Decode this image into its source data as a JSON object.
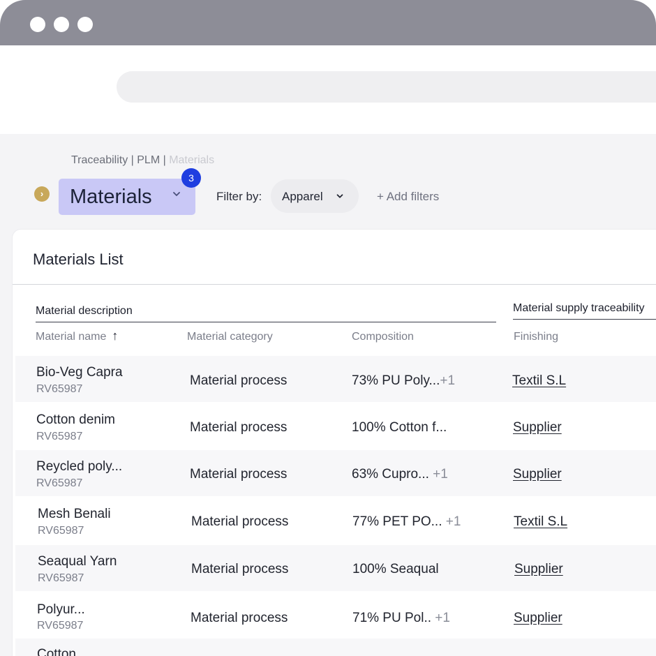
{
  "breadcrumb": {
    "path": "Traceability | PLM | ",
    "current": "Materials"
  },
  "header": {
    "view_select_label": "Materials",
    "badge_count": "3",
    "filter_label": "Filter by:",
    "filter_value": "Apparel",
    "add_filters": "+ Add filters"
  },
  "card": {
    "title": "Materials List"
  },
  "table": {
    "groups": [
      "Material description",
      "Material supply traceability"
    ],
    "columns": [
      "Material name",
      "Material category",
      "Composition",
      "Finishing"
    ],
    "rows": [
      {
        "name": "Bio-Veg Capra",
        "code": "RV65987",
        "category": "Material process",
        "composition": "73% PU Poly...",
        "more": "+1",
        "finishing": "Textil S.L"
      },
      {
        "name": "Cotton denim",
        "code": "RV65987",
        "category": "Material process",
        "composition": "100% Cotton f...",
        "more": "",
        "finishing": "Supplier"
      },
      {
        "name": "Reycled poly...",
        "code": "RV65987",
        "category": "Material process",
        "composition": "63% Cupro... ",
        "more": "+1",
        "finishing": "Supplier"
      },
      {
        "name": "Mesh Benali",
        "code": "RV65987",
        "category": "Material process",
        "composition": "77% PET PO... ",
        "more": "+1",
        "finishing": "Textil S.L"
      },
      {
        "name": "Seaqual Yarn",
        "code": "RV65987",
        "category": "Material process",
        "composition": "100% Seaqual",
        "more": "",
        "finishing": "Supplier"
      },
      {
        "name": "Polyur...",
        "code": "RV65987",
        "category": "Material process",
        "composition": "71% PU Pol.. ",
        "more": "+1",
        "finishing": "Supplier"
      },
      {
        "name": "Cotton",
        "code": "",
        "category": "",
        "composition": "",
        "more": "",
        "finishing": ""
      }
    ]
  },
  "icons": {
    "sort": "up-arrow-icon",
    "expand": "chevron-right-icon",
    "dropdown": "chevron-down-icon"
  },
  "colors": {
    "accent_badge": "#1f3ee0",
    "view_select_bg": "#c9c8f6",
    "expand_button": "#c8a85a",
    "titlebar": "#8d8d97"
  }
}
